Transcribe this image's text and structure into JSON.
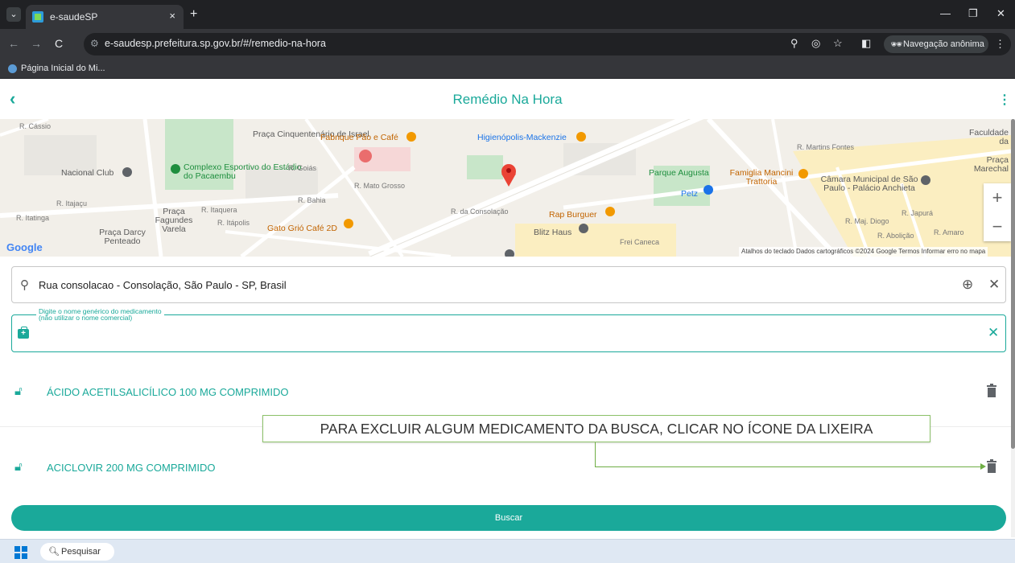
{
  "browser": {
    "tab_title": "e-saudeSP",
    "tab_close": "×",
    "new_tab": "+",
    "url": "e-saudesp.prefeitura.sp.gov.br/#/remedio-na-hora",
    "incognito_label": "Navegação anônima",
    "bookmark": "Página Inicial do Mi...",
    "icons": [
      "tab-search-icon",
      "back-icon",
      "forward-icon",
      "reload-icon",
      "site-info-icon",
      "location-icon",
      "eye-off-icon",
      "star-icon",
      "sidebar-icon",
      "incognito-icon",
      "menu-icon",
      "minimize-icon",
      "restore-icon",
      "close-icon"
    ]
  },
  "app": {
    "title": "Remédio Na Hora",
    "back": "‹",
    "menu": "⋮"
  },
  "map": {
    "labels": [
      "Praça Cinquentenário de Israel",
      "Fabrique Pão e Café",
      "Higienópolis-Mackenzie",
      "Complexo Esportivo do Estádio do Pacaembu",
      "Nacional Club",
      "R. Goiás",
      "R. Mato Grosso",
      "R. da Consolação",
      "Parque Augusta",
      "Famiglia Mancini Trattoria",
      "Câmara Municipal de São Paulo - Palácio Anchieta",
      "Petz",
      "Rap Burguer",
      "Blitz Haus",
      "Gato Grió Café 2D",
      "Praça Fagundes Varela",
      "Praça Darcy Penteado",
      "R. Itatinga",
      "R. Itajaçu",
      "R. Itaquera",
      "R. Itápolis",
      "R. Bahia",
      "R. Martins Fontes",
      "Faculdade da Universidade",
      "Praça Marechal Câmara",
      "R. Cássio",
      "Frei Caneca",
      "R. Maj. Diogo",
      "R. Japurá",
      "R. Abolição",
      "R. Amaro"
    ],
    "zoom_in": "+",
    "zoom_out": "−",
    "google": "Google",
    "attribution": "Atalhos do teclado   Dados cartográficos ©2024 Google   Termos   Informar erro no mapa"
  },
  "address": {
    "value": "Rua consolacao - Consolação, São Paulo - SP, Brasil"
  },
  "medicine_input": {
    "label_line1": "Digite o nome genérico do medicamento",
    "label_line2": "(não utilizar o nome comercial)",
    "value": ""
  },
  "medicines": [
    {
      "name": "ÁCIDO ACETILSALICÍLICO 100 MG COMPRIMIDO"
    },
    {
      "name": "ACICLOVIR 200 MG COMPRIMIDO"
    }
  ],
  "callout": "PARA EXCLUIR ALGUM MEDICAMENTO DA BUSCA, CLICAR NO ÍCONE DA LIXEIRA",
  "search_button": "Buscar",
  "taskbar": {
    "search": "Pesquisar"
  },
  "colors": {
    "accent": "#1aa99a",
    "callout_border": "#8dc26a"
  }
}
